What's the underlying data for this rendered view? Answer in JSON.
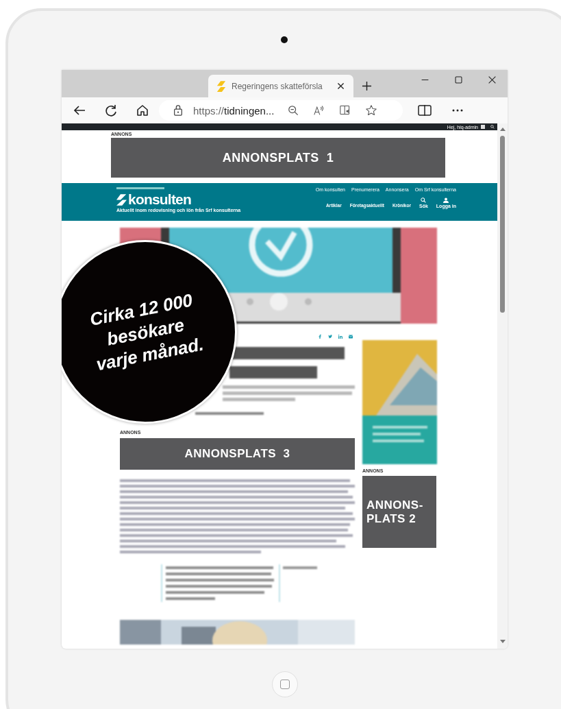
{
  "browser": {
    "tab_title": "Regeringens skatteförsla",
    "url_scheme": "https://",
    "url_host": "tidningen..."
  },
  "site": {
    "greeting": "Hej, hiq-admin",
    "ads": [
      {
        "label": "ANNONS",
        "text": "ANNONSPLATS  1"
      },
      {
        "label": "ANNONS",
        "text": "ANNONSPLATS  3"
      },
      {
        "label": "ANNONS",
        "text": "ANNONS-\nPLATS 2"
      }
    ],
    "header": {
      "logo": "konsulten",
      "tagline": "Aktuellt inom redovisning och lön från Srf konsulterna",
      "top_links": [
        "Om konsulten",
        "Prenumerera",
        "Annonsera",
        "Om Srf konsulterna"
      ],
      "nav": [
        "Artiklar",
        "Företagsaktuellt",
        "Krönikor"
      ],
      "actions": [
        {
          "kind": "search",
          "label": "Sök"
        },
        {
          "kind": "login",
          "label": "Logga in"
        }
      ]
    }
  },
  "badge": {
    "lines": [
      "Cirka 12 000",
      "besökare",
      "varje månad."
    ]
  }
}
